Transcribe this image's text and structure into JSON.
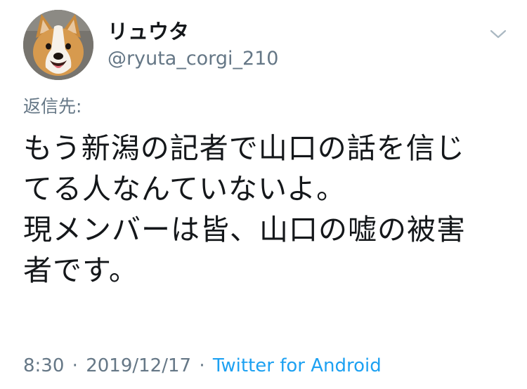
{
  "author": {
    "display_name": "リュウタ",
    "handle": "@ryuta_corgi_210",
    "avatar_icon": "corgi-avatar-photo"
  },
  "menu_icon": "chevron-down-icon",
  "reply_to_label": "返信先:",
  "tweet": {
    "lines": [
      "もう新潟の記者で山口の話を信じ",
      "てる人なんていないよ。",
      "現メンバーは皆、山口の嘘の被害",
      "者です。"
    ]
  },
  "meta": {
    "time": "8:30",
    "separator": "·",
    "date": "2019/12/17",
    "source": "Twitter for Android"
  },
  "colors": {
    "text": "#14171a",
    "secondary": "#657786",
    "link": "#1da1f2"
  }
}
